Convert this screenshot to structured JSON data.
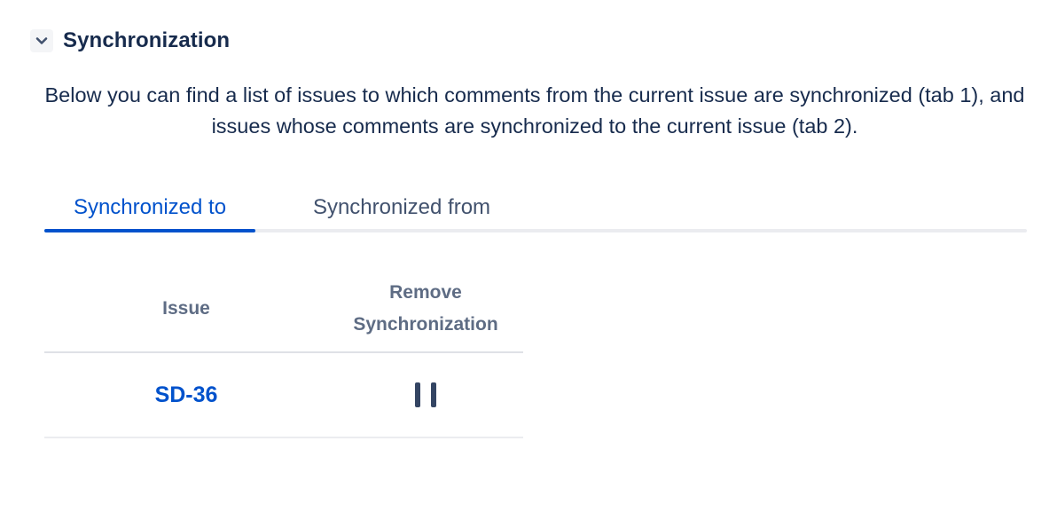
{
  "section": {
    "title": "Synchronization",
    "toggle_icon": "chevron-down-icon",
    "description": "Below you can find a list of issues to which comments from the current issue are synchronized (tab 1), and issues whose comments are synchronized to the current issue (tab 2)."
  },
  "tabs": [
    {
      "label": "Synchronized to",
      "active": true
    },
    {
      "label": "Synchronized from",
      "active": false
    }
  ],
  "table": {
    "headers": {
      "issue": "Issue",
      "remove_line1": "Remove",
      "remove_line2": "Synchronization"
    },
    "rows": [
      {
        "issue": "SD-36",
        "action_icon": "pause-icon"
      }
    ]
  },
  "colors": {
    "accent": "#0052cc",
    "text": "#172b4d",
    "muted": "#5e6c84",
    "border": "#dfe1e6"
  }
}
